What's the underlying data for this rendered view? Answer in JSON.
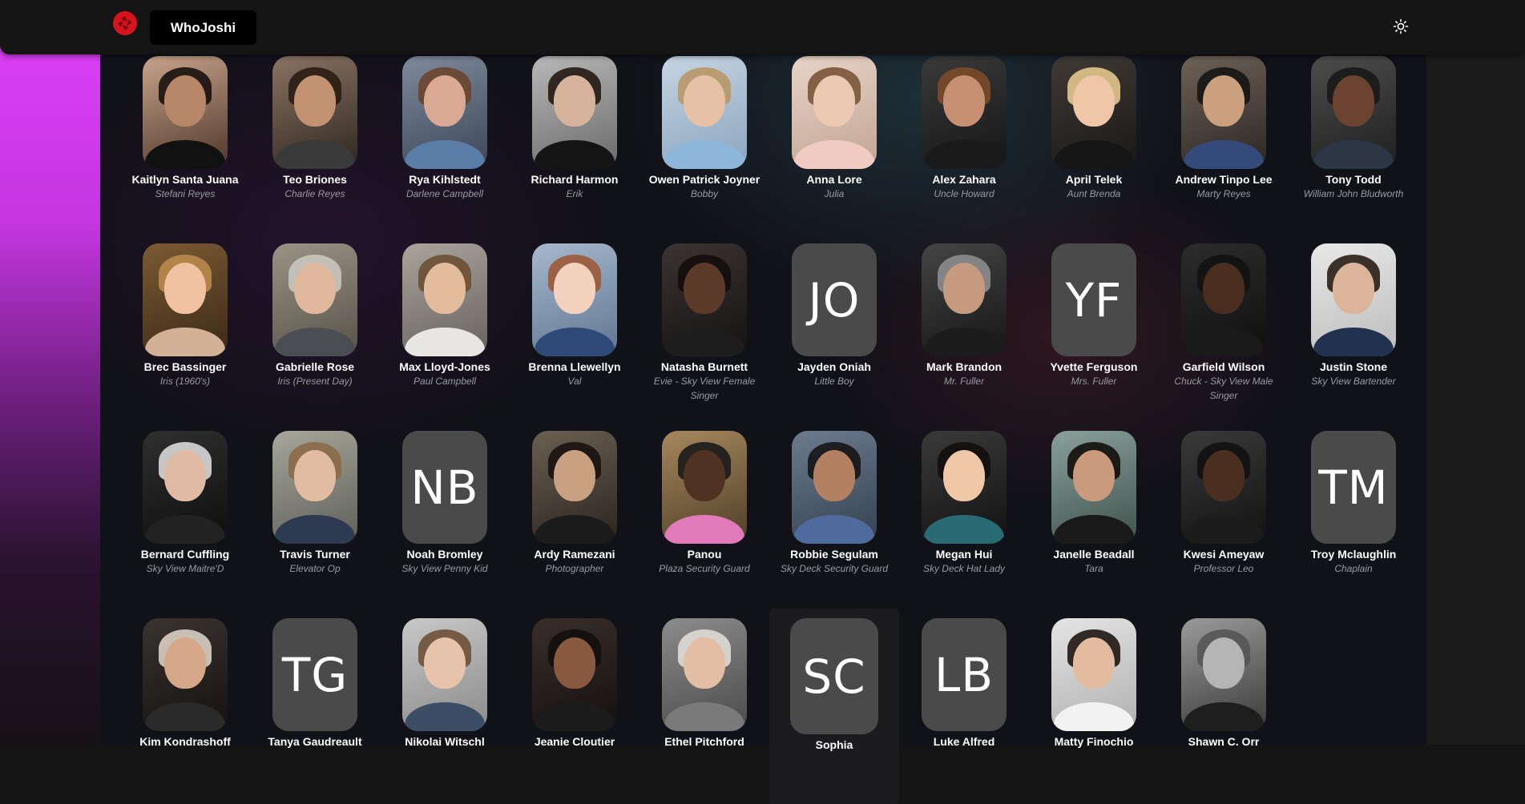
{
  "header": {
    "brand": "WhoJoshi",
    "logo_icon": "camera-shutter-icon",
    "theme_icon": "sun-icon"
  },
  "cast": [
    {
      "name": "Kaitlyn Santa Juana",
      "role": "Stefani Reyes",
      "c1": "#c9a48c",
      "c2": "#4b3529",
      "skin": "#b8876a",
      "hair": "#1a120e",
      "shirt": "#111111"
    },
    {
      "name": "Teo Briones",
      "role": "Charlie Reyes",
      "c1": "#8a7464",
      "c2": "#2e2620",
      "skin": "#c39273",
      "hair": "#2a1c14",
      "shirt": "#3a3a3a"
    },
    {
      "name": "Rya Kihlstedt",
      "role": "Darlene Campbell",
      "c1": "#7f8a9b",
      "c2": "#3b4658",
      "skin": "#d9a993",
      "hair": "#6b4530",
      "shirt": "#5b7ea8"
    },
    {
      "name": "Richard Harmon",
      "role": "Erik",
      "c1": "#b8b8b8",
      "c2": "#6a6a6a",
      "skin": "#d8b39c",
      "hair": "#241a14",
      "shirt": "#141414"
    },
    {
      "name": "Owen Patrick Joyner",
      "role": "Bobby",
      "c1": "#c6d5e2",
      "c2": "#8aa4be",
      "skin": "#e6c1a6",
      "hair": "#b89868",
      "shirt": "#8eb6d8"
    },
    {
      "name": "Anna Lore",
      "role": "Julia",
      "c1": "#e7d4c8",
      "c2": "#c2a493",
      "skin": "#ecc9b3",
      "hair": "#7a5538",
      "shirt": "#f1cbc2"
    },
    {
      "name": "Alex Zahara",
      "role": "Uncle Howard",
      "c1": "#3a3a3a",
      "c2": "#151515",
      "skin": "#c89072",
      "hair": "#7a4a2a",
      "shirt": "#1a1a1a"
    },
    {
      "name": "April Telek",
      "role": "Aunt Brenda",
      "c1": "#3f3a36",
      "c2": "#1a1714",
      "skin": "#efc6a8",
      "hair": "#e3c78d",
      "shirt": "#161616"
    },
    {
      "name": "Andrew Tinpo Lee",
      "role": "Marty Reyes",
      "c1": "#6e6258",
      "c2": "#2b2622",
      "skin": "#caa07e",
      "hair": "#151515",
      "shirt": "#344a7a"
    },
    {
      "name": "Tony Todd",
      "role": "William John Bludworth",
      "c1": "#4d4d4d",
      "c2": "#1e1e1e",
      "skin": "#6b4330",
      "hair": "#1a1a1a",
      "shirt": "#2c3644"
    },
    {
      "name": "Brec Bassinger",
      "role": "Iris (1960's)",
      "c1": "#7b5a34",
      "c2": "#3a2916",
      "skin": "#f0c2a2",
      "hair": "#b98a4c",
      "shirt": "#d3b197"
    },
    {
      "name": "Gabrielle Rose",
      "role": "Iris (Present Day)",
      "c1": "#9a9386",
      "c2": "#575148",
      "skin": "#e0b89d",
      "hair": "#c8c6c0",
      "shirt": "#4a4e52"
    },
    {
      "name": "Max Lloyd-Jones",
      "role": "Paul Campbell",
      "c1": "#a9a49c",
      "c2": "#66625c",
      "skin": "#e3bb9d",
      "hair": "#6d5034",
      "shirt": "#e8e6e2"
    },
    {
      "name": "Brenna Llewellyn",
      "role": "Val",
      "c1": "#a6b8cc",
      "c2": "#5f7691",
      "skin": "#f3d2bf",
      "hair": "#9c5a38",
      "shirt": "#2f4a78"
    },
    {
      "name": "Natasha Burnett",
      "role": "Evie - Sky View Female Singer",
      "c1": "#3a3432",
      "c2": "#141212",
      "skin": "#5b3a2a",
      "hair": "#120d0b",
      "shirt": "#1d1d1d"
    },
    {
      "name": "Jayden Oniah",
      "role": "Little Boy",
      "initials": "JO"
    },
    {
      "name": "Mark Brandon",
      "role": "Mr. Fuller",
      "c1": "#454545",
      "c2": "#151515",
      "skin": "#c59a7e",
      "hair": "#8d8d8d",
      "shirt": "#1c1c1c"
    },
    {
      "name": "Yvette Ferguson",
      "role": "Mrs. Fuller",
      "initials": "YF"
    },
    {
      "name": "Garfield Wilson",
      "role": "Chuck - Sky View Male Singer",
      "c1": "#2c2c2c",
      "c2": "#0f0f0f",
      "skin": "#4a2e20",
      "hair": "#121212",
      "shirt": "#1a1a1a"
    },
    {
      "name": "Justin Stone",
      "role": "Sky View Bartender",
      "c1": "#e8e8e8",
      "c2": "#bcbcbc",
      "skin": "#dcb49a",
      "hair": "#2a1e16",
      "shirt": "#22324e"
    },
    {
      "name": "Bernard Cuffling",
      "role": "Sky View Maitre'D",
      "c1": "#2f2f2f",
      "c2": "#0e0e0e",
      "skin": "#e0baa3",
      "hair": "#d8d8d8",
      "shirt": "#222222"
    },
    {
      "name": "Travis Turner",
      "role": "Elevator Op",
      "c1": "#a6a69a",
      "c2": "#5e5f58",
      "skin": "#e1bca1",
      "hair": "#8a6a48",
      "shirt": "#2e3a52"
    },
    {
      "name": "Noah Bromley",
      "role": "Sky View Penny Kid",
      "initials": "NB"
    },
    {
      "name": "Ardy Ramezani",
      "role": "Photographer",
      "c1": "#6b5f52",
      "c2": "#2a241e",
      "skin": "#caa083",
      "hair": "#18120e",
      "shirt": "#1b1b1b"
    },
    {
      "name": "Panou",
      "role": "Plaza Security Guard",
      "c1": "#a5885e",
      "c2": "#4f3e26",
      "skin": "#4f3222",
      "hair": "#1a1a1a",
      "shirt": "#e07ab8"
    },
    {
      "name": "Robbie Segulam",
      "role": "Sky Deck Security Guard",
      "c1": "#6d7b8e",
      "c2": "#33404f",
      "skin": "#b48062",
      "hair": "#151515",
      "shirt": "#4f6a9c"
    },
    {
      "name": "Megan Hui",
      "role": "Sky Deck Hat Lady",
      "c1": "#3a3a3a",
      "c2": "#121212",
      "skin": "#efc8a8",
      "hair": "#120e0c",
      "shirt": "#2a6a74"
    },
    {
      "name": "Janelle Beadall",
      "role": "Tara",
      "c1": "#8aa09a",
      "c2": "#3e524c",
      "skin": "#c99a7c",
      "hair": "#120e0c",
      "shirt": "#1a1a1a"
    },
    {
      "name": "Kwesi Ameyaw",
      "role": "Professor Leo",
      "c1": "#3a3a3a",
      "c2": "#121212",
      "skin": "#4a2e20",
      "hair": "#111111",
      "shirt": "#1c1c1c"
    },
    {
      "name": "Troy Mclaughlin",
      "role": "Chaplain",
      "initials": "TM"
    },
    {
      "name": "Kim Kondrashoff",
      "role": "",
      "c1": "#3a3430",
      "c2": "#141110",
      "skin": "#d6a889",
      "hair": "#d9cfc4",
      "shirt": "#2a2a2a"
    },
    {
      "name": "Tanya Gaudreault",
      "role": "",
      "initials": "TG"
    },
    {
      "name": "Nikolai Witschl",
      "role": "",
      "c1": "#c8c8c8",
      "c2": "#8a8a8a",
      "skin": "#e6c3aa",
      "hair": "#6e5038",
      "shirt": "#3c4e66"
    },
    {
      "name": "Jeanie Cloutier",
      "role": "",
      "c1": "#3a2e2a",
      "c2": "#141010",
      "skin": "#8a5a40",
      "hair": "#120e0c",
      "shirt": "#1c1c1c"
    },
    {
      "name": "Ethel Pitchford",
      "role": "",
      "c1": "#8c8c8c",
      "c2": "#4a4a4a",
      "skin": "#e3bda4",
      "hair": "#e0dcd6",
      "shirt": "#7a7a7a"
    },
    {
      "name": "Sophia",
      "role": "",
      "initials": "SC",
      "highlight": true
    },
    {
      "name": "Luke Alfred",
      "role": "",
      "initials": "LB"
    },
    {
      "name": "Matty Finochio",
      "role": "",
      "c1": "#e4e4e4",
      "c2": "#b0b0b0",
      "skin": "#e3bca0",
      "hair": "#1e1612",
      "shirt": "#f2f2f2"
    },
    {
      "name": "Shawn C. Orr",
      "role": "",
      "c1": "#9a9a9a",
      "c2": "#3a3a3a",
      "skin": "#b5b5b5",
      "hair": "#555555",
      "shirt": "#1e1e1e"
    }
  ]
}
